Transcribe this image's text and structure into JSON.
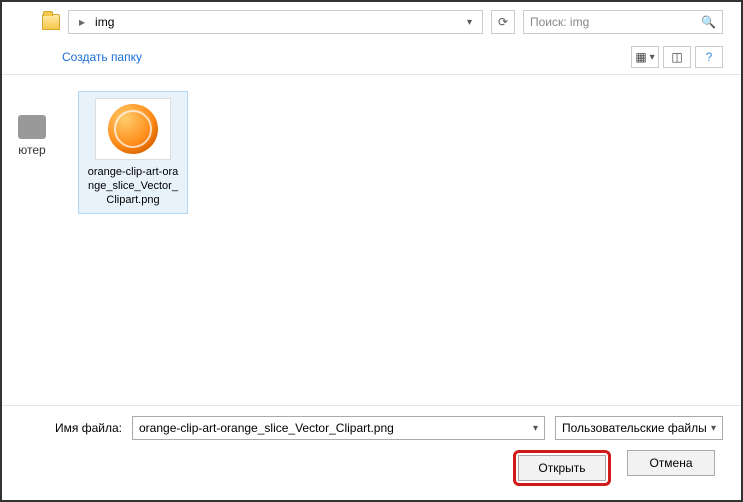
{
  "breadcrumb": {
    "current": "img"
  },
  "search": {
    "placeholder": "Поиск: img"
  },
  "toolbar": {
    "new_folder": "Создать папку"
  },
  "sidebar": {
    "label": "ютер"
  },
  "file": {
    "display_name": "orange-clip-art-orange_slice_Vector_Clipart.png"
  },
  "footer": {
    "filename_label": "Имя файла:",
    "filename_value": "orange-clip-art-orange_slice_Vector_Clipart.png",
    "filter_label": "Пользовательские файлы",
    "open": "Открыть",
    "cancel": "Отмена"
  }
}
